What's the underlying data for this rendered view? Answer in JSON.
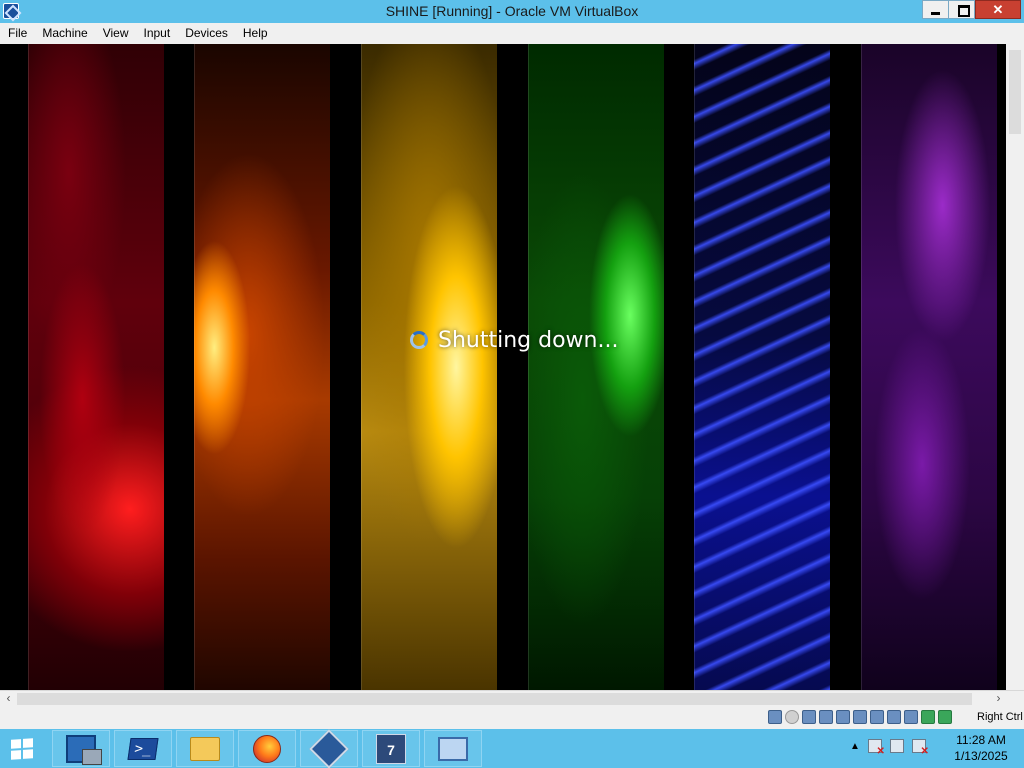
{
  "window": {
    "title": "SHINE [Running] - Oracle VM VirtualBox"
  },
  "menu": {
    "items": [
      "File",
      "Machine",
      "View",
      "Input",
      "Devices",
      "Help"
    ]
  },
  "vm": {
    "status_text": "Shutting down..."
  },
  "statusbar": {
    "host_key": "Right Ctrl",
    "icons": [
      "hard-disk-icon",
      "optical-drive-icon",
      "audio-icon",
      "network-icon",
      "usb-icon",
      "shared-folders-icon",
      "display-icon",
      "video-capture-icon",
      "virtualization-icon",
      "mouse-integration-icon"
    ]
  },
  "taskbar": {
    "apps": [
      "start-button",
      "server-manager",
      "powershell",
      "file-explorer",
      "firefox",
      "virtualbox",
      "windows-7-vm",
      "remote-desktop"
    ],
    "clock_time": "11:28 AM",
    "clock_date": "1/13/2025"
  },
  "colors": {
    "titlebar": "#5cc0ea",
    "taskbar": "#5cc0ea",
    "close_button": "#c84031"
  }
}
